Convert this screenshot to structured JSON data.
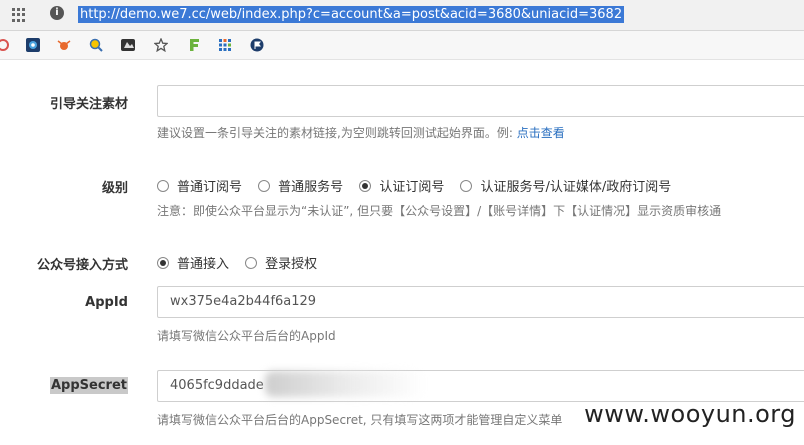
{
  "browser": {
    "url": "http://demo.we7.cc/web/index.php?c=account&a=post&acid=3680&uniacid=3682"
  },
  "form": {
    "guide": {
      "label": "引导关注素材",
      "value": "",
      "help_text": "建议设置一条引导关注的素材链接,为空则跳转回测试起始界面。例: ",
      "help_link": "点击查看"
    },
    "level": {
      "label": "级别",
      "options": [
        "普通订阅号",
        "普通服务号",
        "认证订阅号",
        "认证服务号/认证媒体/政府订阅号"
      ],
      "selected": "认证订阅号",
      "note": "注意：即使公众平台显示为“未认证”, 但只要【公众号设置】/【账号详情】下【认证情况】显示资质审核通"
    },
    "access": {
      "label": "公众号接入方式",
      "options": [
        "普通接入",
        "登录授权"
      ],
      "selected": "普通接入"
    },
    "appid": {
      "label": "AppId",
      "value": "wx375e4a2b44f6a129",
      "help_text": "请填写微信公众平台后台的AppId"
    },
    "appsecret": {
      "label": "AppSecret",
      "value": "4065fc9ddade",
      "help_text": "请填写微信公众平台后台的AppSecret, 只有填写这两项才能管理自定义菜单"
    }
  },
  "watermark": "www.wooyun.org"
}
